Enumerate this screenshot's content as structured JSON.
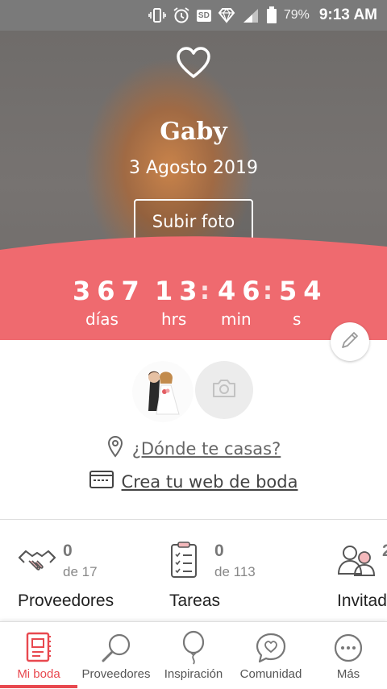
{
  "status_bar": {
    "battery_percent": "79%",
    "time": "9:13 AM",
    "sd_label": "SD",
    "icons": [
      "vibrate-icon",
      "alarm-icon",
      "sd-card-icon",
      "signal-diamond-icon",
      "cell-signal-icon",
      "battery-icon"
    ]
  },
  "hero": {
    "name": "Gaby",
    "date": "3 Agosto 2019",
    "upload_button": "Subir foto",
    "icon": "heart-outline-icon",
    "accent_color": "#ef6a6f"
  },
  "countdown": {
    "days": "367",
    "hours": "13",
    "minutes": "46",
    "seconds": "54",
    "colon": ":",
    "days_label": "días",
    "hours_label": "hrs",
    "minutes_label": "min",
    "seconds_label": "s"
  },
  "links": {
    "place": "¿Dónde te casas?",
    "website": "Crea tu web de boda"
  },
  "summary": [
    {
      "count": "0",
      "total": "de 17",
      "title": "Proveedores",
      "icon": "handshake-icon"
    },
    {
      "count": "0",
      "total": "de 113",
      "title": "Tareas",
      "icon": "checklist-icon"
    },
    {
      "count": "2",
      "total": "",
      "title": "Invitad",
      "icon": "guests-icon"
    }
  ],
  "nav": [
    {
      "label": "Mi boda",
      "icon": "wedding-book-icon",
      "active": true
    },
    {
      "label": "Proveedores",
      "icon": "search-icon",
      "active": false
    },
    {
      "label": "Inspiración",
      "icon": "balloon-icon",
      "active": false
    },
    {
      "label": "Comunidad",
      "icon": "chat-heart-icon",
      "active": false
    },
    {
      "label": "Más",
      "icon": "more-icon",
      "active": false
    }
  ],
  "colors": {
    "brand": "#e8484f",
    "countdown_band": "#ef6a6f"
  }
}
